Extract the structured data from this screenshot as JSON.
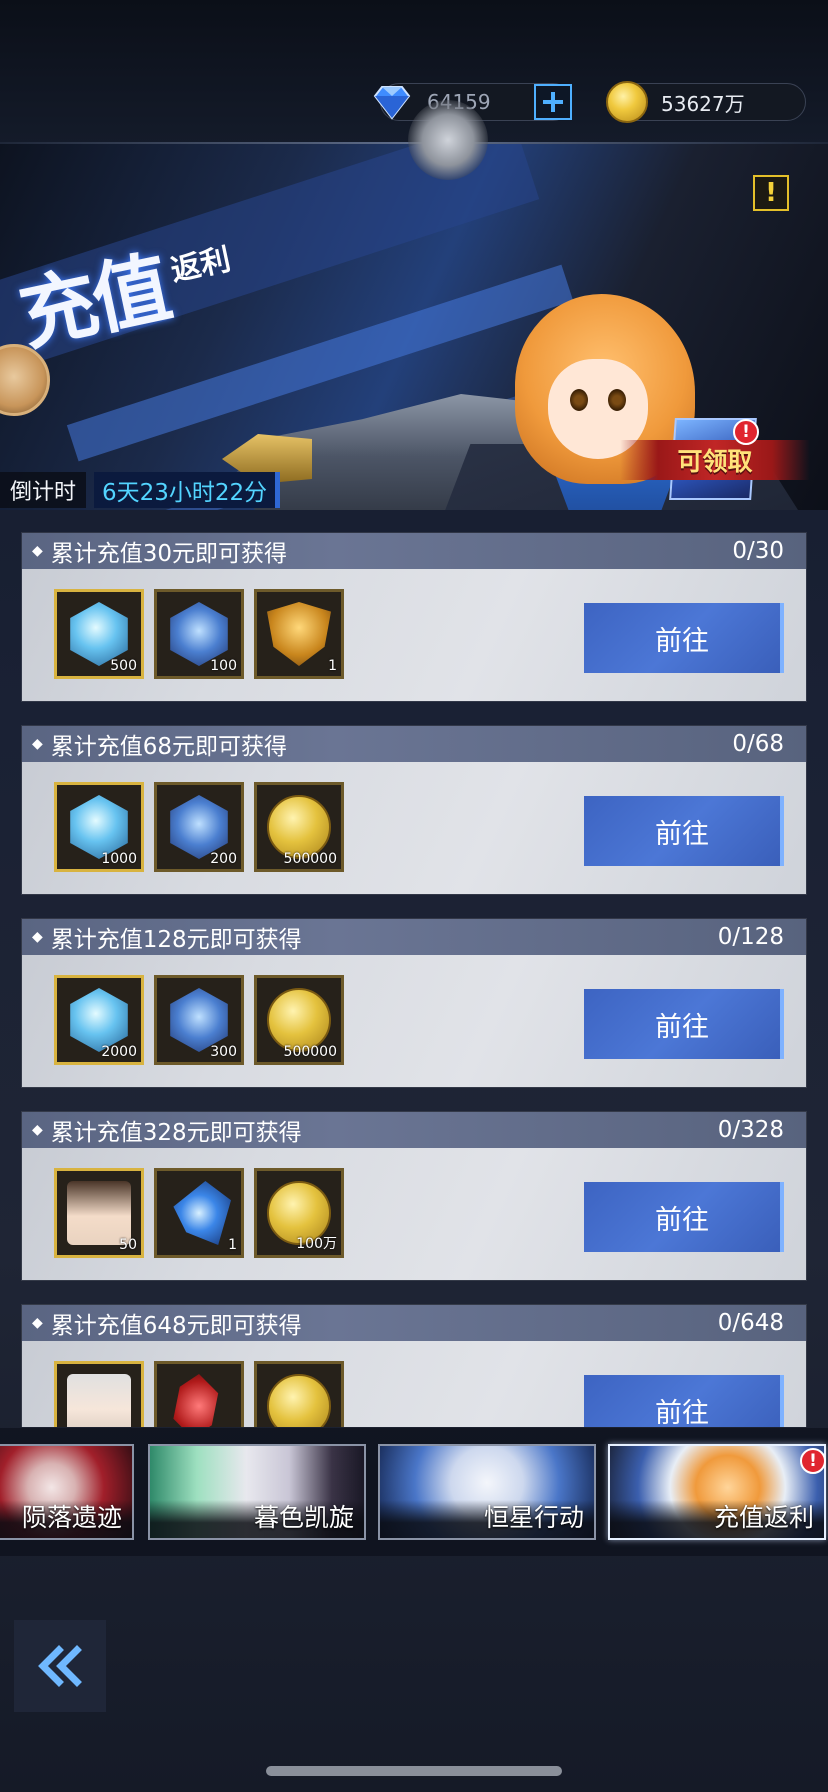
{
  "currency": {
    "diamond_icon": "diamond-icon",
    "diamonds": "64159",
    "add_icon": "plus-icon",
    "gold_icon": "gold-coin-icon",
    "gold": "53627万"
  },
  "banner": {
    "title_art": "充值",
    "title_sub": "返利",
    "warning_icon": "exclamation-icon",
    "warning_text": "!",
    "claim_label": "可领取",
    "claim_badge": "!",
    "countdown_label": "倒计时",
    "countdown_value": "6天23小时22分"
  },
  "tasks": [
    {
      "title": "累计充值30元即可获得",
      "progress": "0/30",
      "button": "前往",
      "rewards": [
        {
          "icon": "egg-icon",
          "count": "500"
        },
        {
          "icon": "chip-icon",
          "count": "100"
        },
        {
          "icon": "shield-icon",
          "count": "1"
        }
      ]
    },
    {
      "title": "累计充值68元即可获得",
      "progress": "0/68",
      "button": "前往",
      "rewards": [
        {
          "icon": "egg-icon",
          "count": "1000"
        },
        {
          "icon": "chip-icon",
          "count": "200"
        },
        {
          "icon": "coin-icon",
          "count": "500000"
        }
      ]
    },
    {
      "title": "累计充值128元即可获得",
      "progress": "0/128",
      "button": "前往",
      "rewards": [
        {
          "icon": "egg-icon",
          "count": "2000"
        },
        {
          "icon": "chip-icon",
          "count": "300"
        },
        {
          "icon": "coin-icon",
          "count": "500000"
        }
      ]
    },
    {
      "title": "累计充值328元即可获得",
      "progress": "0/328",
      "button": "前往",
      "rewards": [
        {
          "icon": "character-portrait-icon",
          "count": "50"
        },
        {
          "icon": "crystal-icon",
          "count": "1"
        },
        {
          "icon": "coin-icon",
          "count": "100万"
        }
      ]
    },
    {
      "title": "累计充值648元即可获得",
      "progress": "0/648",
      "button": "前往",
      "rewards": [
        {
          "icon": "character-portrait-icon",
          "count": ""
        },
        {
          "icon": "red-fragment-icon",
          "count": ""
        },
        {
          "icon": "coin-icon",
          "count": ""
        }
      ]
    }
  ],
  "event_tabs": [
    {
      "label": "陨落遗迹",
      "active": false
    },
    {
      "label": "暮色凯旋",
      "active": false
    },
    {
      "label": "恒星行动",
      "active": false
    },
    {
      "label": "充值返利",
      "active": true,
      "badge": "!"
    }
  ],
  "navigation": {
    "back_icon": "double-chevron-left-icon"
  },
  "colors": {
    "accent_blue": "#4c77d6",
    "countdown_cyan": "#53d4ff",
    "badge_red": "#e0262f",
    "gold": "#e4c23e"
  }
}
